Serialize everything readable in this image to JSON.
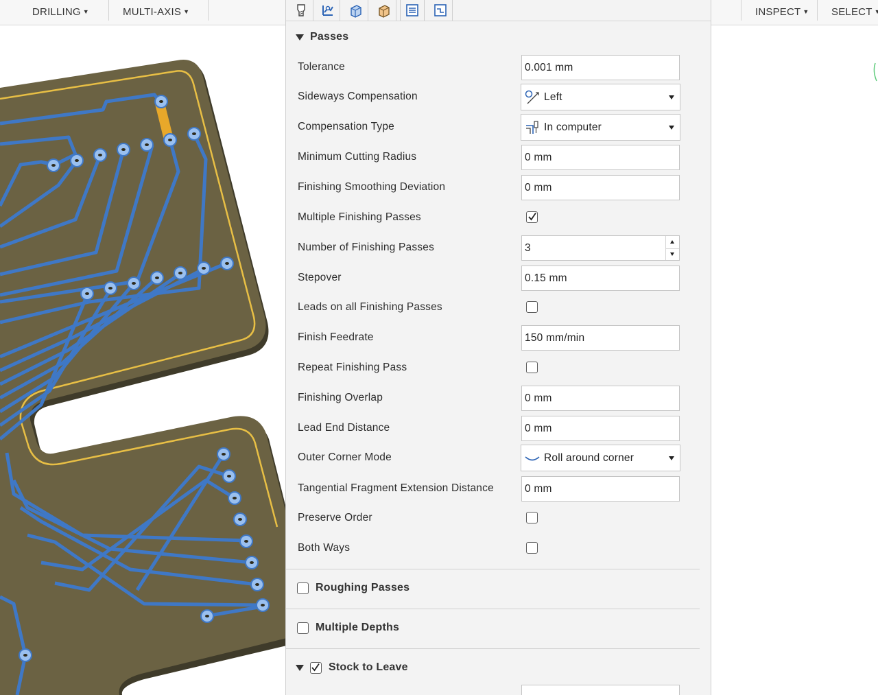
{
  "toolbar": {
    "left_items": [
      "DRILLING",
      "MULTI-AXIS"
    ],
    "right_items": [
      "INSPECT",
      "SELECT"
    ]
  },
  "tabs": [
    {
      "icon": "tool-icon"
    },
    {
      "icon": "geometry-icon"
    },
    {
      "icon": "heights-icon"
    },
    {
      "icon": "stock-icon"
    },
    {
      "icon": "passes-icon",
      "active": true
    },
    {
      "icon": "linking-icon"
    }
  ],
  "passes": {
    "title": "Passes",
    "tolerance": {
      "label": "Tolerance",
      "value": "0.001 mm"
    },
    "sideways_compensation": {
      "label": "Sideways Compensation",
      "value": "Left"
    },
    "compensation_type": {
      "label": "Compensation Type",
      "value": "In computer"
    },
    "min_cutting_radius": {
      "label": "Minimum Cutting Radius",
      "value": "0 mm"
    },
    "finishing_smoothing_deviation": {
      "label": "Finishing Smoothing Deviation",
      "value": "0 mm"
    },
    "multiple_finishing_passes": {
      "label": "Multiple Finishing Passes",
      "checked": true
    },
    "number_of_finishing_passes": {
      "label": "Number of Finishing Passes",
      "value": "3"
    },
    "stepover": {
      "label": "Stepover",
      "value": "0.15 mm"
    },
    "leads_on_all_finishing_passes": {
      "label": "Leads on all Finishing Passes",
      "checked": false
    },
    "finish_feedrate": {
      "label": "Finish Feedrate",
      "value": "150 mm/min"
    },
    "repeat_finishing_pass": {
      "label": "Repeat Finishing Pass",
      "checked": false
    },
    "finishing_overlap": {
      "label": "Finishing Overlap",
      "value": "0 mm"
    },
    "lead_end_distance": {
      "label": "Lead End Distance",
      "value": "0 mm"
    },
    "outer_corner_mode": {
      "label": "Outer Corner Mode",
      "value": "Roll around corner"
    },
    "tangential_fragment_extension_distance": {
      "label": "Tangential Fragment Extension Distance",
      "value": "0 mm"
    },
    "preserve_order": {
      "label": "Preserve Order",
      "checked": false
    },
    "both_ways": {
      "label": "Both Ways",
      "checked": false
    }
  },
  "roughing_passes": {
    "title": "Roughing Passes",
    "checked": false
  },
  "multiple_depths": {
    "title": "Multiple Depths",
    "checked": false
  },
  "stock_to_leave": {
    "title": "Stock to Leave",
    "checked": true
  },
  "colors": {
    "board": "#6b6243",
    "trace": "#3f78c6",
    "outline": "#e8bf45",
    "panel_bg": "#f3f3f3"
  }
}
